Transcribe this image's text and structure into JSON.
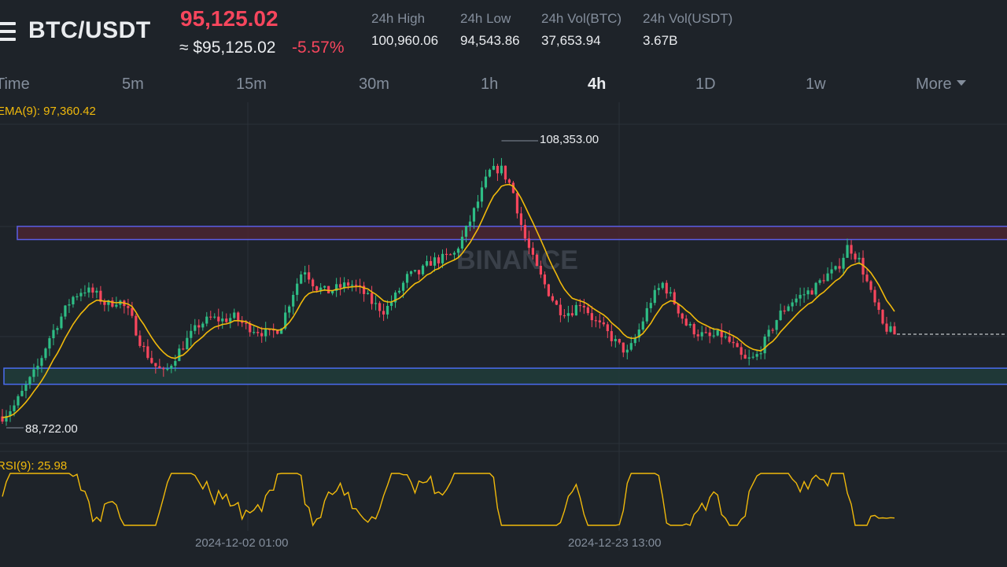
{
  "header": {
    "pair": "BTC/USDT",
    "last_price": "95,125.02",
    "usd_price": "≈ $95,125.02",
    "change_pct": "-5.57%",
    "stats": [
      {
        "label": "24h High",
        "value": "100,960.06"
      },
      {
        "label": "24h Low",
        "value": "94,543.86"
      },
      {
        "label": "24h Vol(BTC)",
        "value": "37,653.94"
      },
      {
        "label": "24h Vol(USDT)",
        "value": "3.67B"
      }
    ]
  },
  "timeframes": [
    "Time",
    "5m",
    "15m",
    "30m",
    "1h",
    "4h",
    "1D",
    "1w",
    "More"
  ],
  "active_timeframe": "4h",
  "indicators": {
    "ema": "EMA(9): 97,360.42",
    "rsi": "RSI(9): 25.98"
  },
  "chart": {
    "high_label": "108,353.00",
    "low_label": "88,722.00",
    "watermark": "BINANCE",
    "time_labels": [
      "2024-12-02 01:00",
      "2024-12-23 13:00"
    ]
  },
  "colors": {
    "up": "#2ebd85",
    "down": "#f6465d",
    "ema": "#f0b90b",
    "resistance_zone_fill": "#4a2530",
    "resistance_zone_border": "#5b5ee6",
    "support_zone_fill": "#1f3b38",
    "support_zone_border": "#4a6cf0",
    "background": "#1e2329"
  },
  "chart_data": {
    "type": "candlestick",
    "interval": "4h",
    "x_labels": [
      "2024-12-02 01:00",
      "2024-12-23 13:00"
    ],
    "y_high": 108353.0,
    "y_low": 88722.0,
    "last_price": 95125.02,
    "ema9_last": 97360.42,
    "rsi9_last": 25.98,
    "zones": [
      {
        "kind": "resistance",
        "from": 101600,
        "to": 102500
      },
      {
        "kind": "support",
        "from": 91700,
        "to": 92800
      }
    ],
    "closes_approx": [
      89500,
      90200,
      91500,
      92800,
      94800,
      96200,
      97600,
      98200,
      97900,
      97100,
      97500,
      96500,
      94400,
      93100,
      92400,
      93700,
      94800,
      95800,
      96200,
      96100,
      96300,
      95700,
      95400,
      95100,
      95600,
      97800,
      99700,
      98400,
      98000,
      98300,
      98600,
      98100,
      97200,
      96700,
      97800,
      99100,
      99300,
      100100,
      100300,
      100600,
      102200,
      104100,
      106200,
      106500,
      105100,
      101900,
      99800,
      98200,
      96800,
      96600,
      97400,
      96100,
      95400,
      94500,
      93800,
      95500,
      97500,
      98600,
      97300,
      95800,
      95200,
      94900,
      95100,
      94400,
      93300,
      93500,
      94900,
      96400,
      97300,
      97800,
      98200,
      99100,
      99500,
      101200,
      100100,
      97800,
      95700,
      95125
    ]
  }
}
